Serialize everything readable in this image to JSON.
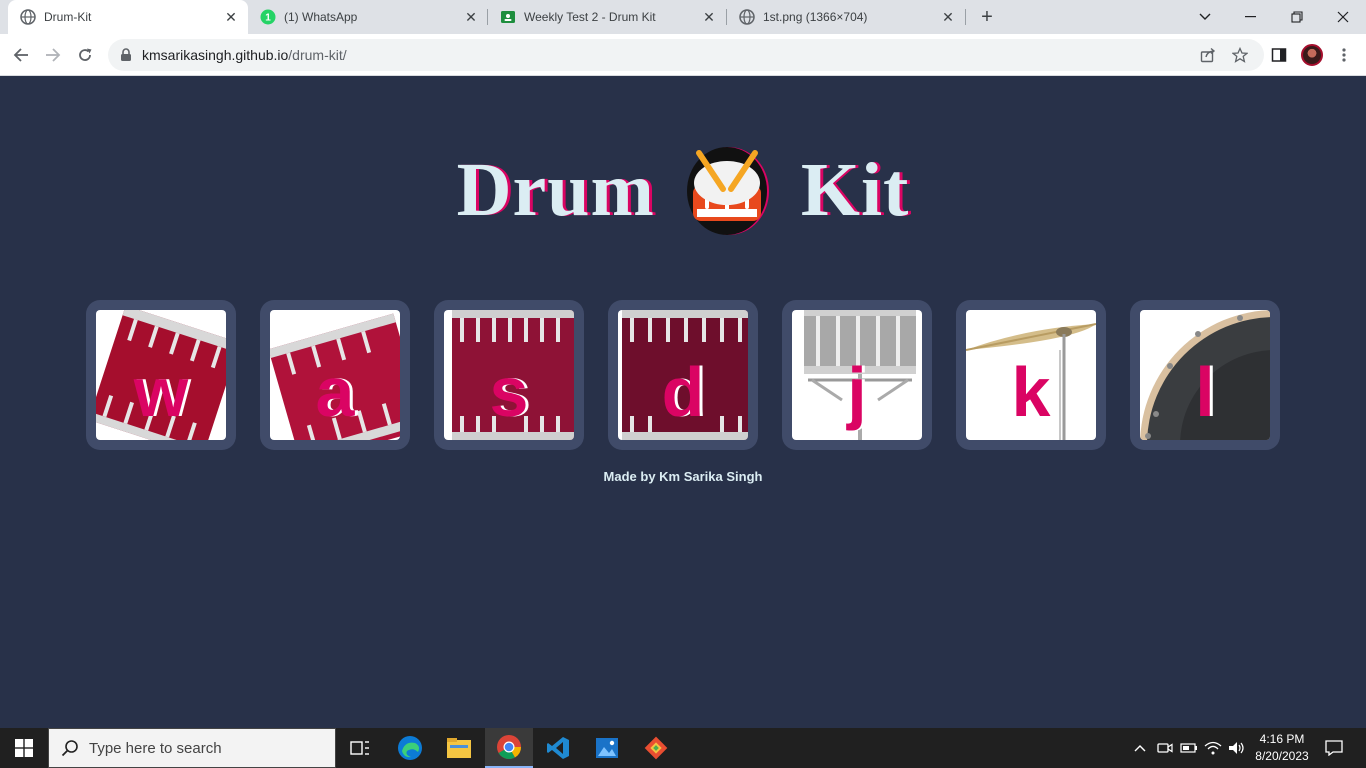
{
  "browser": {
    "tabs": [
      {
        "title": "Drum-Kit",
        "active": true,
        "favicon": "globe-icon"
      },
      {
        "title": "(1) WhatsApp",
        "active": false,
        "favicon": "whatsapp-icon",
        "badge": "1"
      },
      {
        "title": "Weekly Test 2 - Drum Kit",
        "active": false,
        "favicon": "classroom-icon"
      },
      {
        "title": "1st.png (1366×704)",
        "active": false,
        "favicon": "globe-icon"
      }
    ],
    "new_tab_label": "+",
    "address": {
      "host": "kmsarikasingh.github.io",
      "path": "/drum-kit/"
    }
  },
  "page": {
    "title_left": "Drum",
    "title_right": "Kit",
    "title_emoji": "drum-emoji",
    "drums": [
      {
        "key": "w",
        "image": "tom-drum-tilted"
      },
      {
        "key": "a",
        "image": "tom-drum-tilted"
      },
      {
        "key": "s",
        "image": "snare-drum"
      },
      {
        "key": "d",
        "image": "snare-drum-dark"
      },
      {
        "key": "j",
        "image": "snare-stand"
      },
      {
        "key": "k",
        "image": "cymbal"
      },
      {
        "key": "l",
        "image": "bass-drum"
      }
    ],
    "footer": "Made by Km Sarika Singh"
  },
  "taskbar": {
    "search_placeholder": "Type here to search",
    "time": "4:16 PM",
    "date": "8/20/2023"
  },
  "colors": {
    "background": "#283149",
    "tile": "#404b69",
    "accent": "#da0463",
    "title_text": "#dbedf3"
  }
}
